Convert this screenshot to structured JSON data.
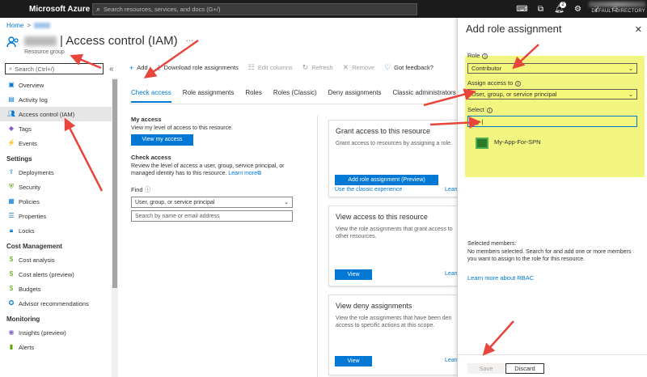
{
  "topbar": {
    "brand": "Microsoft Azure",
    "search_placeholder": "Search resources, services, and docs (G+/)",
    "notification_count": "2",
    "directory": "DEFAULT DIRECTORY",
    "icons": [
      "cloud-shell-icon",
      "directory-filter-icon",
      "notifications-icon",
      "settings-icon",
      "help-icon",
      "feedback-icon"
    ]
  },
  "breadcrumb": {
    "home": "Home",
    "sep": ">"
  },
  "header": {
    "title": "| Access control (IAM)",
    "more": "···",
    "subtitle": "Resource group"
  },
  "sidebar": {
    "search_placeholder": "Search (Ctrl+/)",
    "collapse": "«",
    "items_top": [
      {
        "label": "Overview",
        "icon": "overview-icon"
      },
      {
        "label": "Activity log",
        "icon": "activity-log-icon"
      },
      {
        "label": "Access control (IAM)",
        "icon": "iam-icon",
        "active": true
      },
      {
        "label": "Tags",
        "icon": "tag-icon"
      },
      {
        "label": "Events",
        "icon": "events-icon"
      }
    ],
    "settings_header": "Settings",
    "settings_items": [
      {
        "label": "Deployments",
        "icon": "deployments-icon"
      },
      {
        "label": "Security",
        "icon": "security-icon"
      },
      {
        "label": "Policies",
        "icon": "policies-icon"
      },
      {
        "label": "Properties",
        "icon": "properties-icon"
      },
      {
        "label": "Locks",
        "icon": "lock-icon"
      }
    ],
    "cost_header": "Cost Management",
    "cost_items": [
      {
        "label": "Cost analysis",
        "icon": "cost-analysis-icon"
      },
      {
        "label": "Cost alerts (preview)",
        "icon": "cost-alerts-icon"
      },
      {
        "label": "Budgets",
        "icon": "budgets-icon"
      },
      {
        "label": "Advisor recommendations",
        "icon": "advisor-icon"
      }
    ],
    "monitoring_header": "Monitoring",
    "monitoring_items": [
      {
        "label": "Insights (preview)",
        "icon": "insights-icon"
      },
      {
        "label": "Alerts",
        "icon": "alerts-icon"
      }
    ]
  },
  "toolbar": {
    "add": "Add",
    "download": "Download role assignments",
    "edit_columns": "Edit columns",
    "refresh": "Refresh",
    "remove": "Remove",
    "feedback": "Got feedback?"
  },
  "tabs": [
    "Check access",
    "Role assignments",
    "Roles",
    "Roles (Classic)",
    "Deny assignments",
    "Classic administrators"
  ],
  "check_access": {
    "my_access_h": "My access",
    "my_access_p": "View my level of access to this resource.",
    "view_my_access": "View my access",
    "check_access_h": "Check access",
    "check_access_p": "Review the level of access a user, group, service principal, or managed identity has to this resource.",
    "learn_more": "Learn more",
    "find_label": "Find",
    "find_select": "User, group, or service principal",
    "find_search_placeholder": "Search by name or email address"
  },
  "cards": {
    "grant": {
      "title": "Grant access to this resource",
      "text": "Grant access to resources by assigning a role.",
      "button": "Add role assignment (Preview)",
      "classic_link": "Use the classic experience",
      "learn": "Learn"
    },
    "view": {
      "title": "View access to this resource",
      "text1": "View the role assignments that grant access to",
      "text2": "other resources.",
      "button": "View",
      "learn": "Learn"
    },
    "deny": {
      "title": "View deny assignments",
      "text1": "View the role assignments that have been den",
      "text2": "access to specific actions at this scope.",
      "button": "View",
      "learn": "Learn"
    }
  },
  "panel": {
    "title": "Add role assignment",
    "close": "✕",
    "role_label": "Role",
    "role_value": "Contributor",
    "assign_label": "Assign access to",
    "assign_value": "User, group, or service principal",
    "select_label": "Select",
    "select_value": "My-",
    "result_name": "My-App-For-SPN",
    "selected_h": "Selected members:",
    "selected_p": "No members selected. Search for and add one or more members you want to assign to the role for this resource.",
    "rbac_link": "Learn more about RBAC",
    "save": "Save",
    "discard": "Discard"
  },
  "colors": {
    "accent": "#0078d4",
    "highlight": "#f0f56a",
    "arrow": "#e8453c",
    "topbar": "#1b1b1b"
  }
}
